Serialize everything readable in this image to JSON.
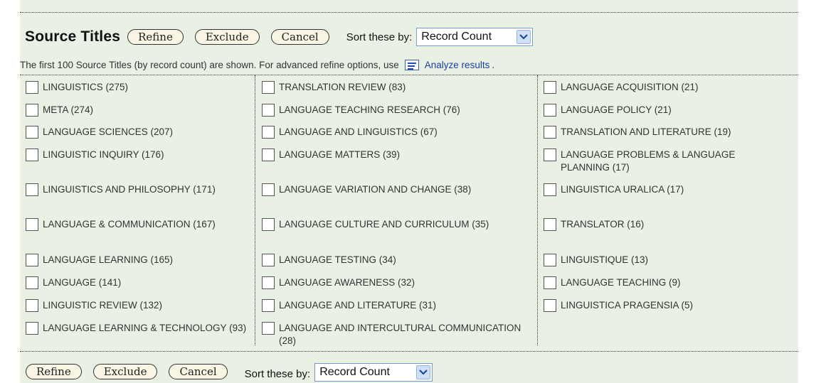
{
  "section_title": "Source Titles",
  "buttons": {
    "refine": "Refine",
    "exclude": "Exclude",
    "cancel": "Cancel"
  },
  "sort": {
    "label": "Sort these by:",
    "selected": "Record Count"
  },
  "info": {
    "text": "The first 100 Source Titles (by record count) are shown. For advanced refine options, use",
    "link": "Analyze results",
    "suffix": "."
  },
  "columns": [
    [
      "LINGUISTICS (275)",
      "META (274)",
      "LANGUAGE SCIENCES (207)",
      "LINGUISTIC INQUIRY (176)",
      "LINGUISTICS AND PHILOSOPHY (171)",
      "LANGUAGE & COMMUNICATION (167)",
      "LANGUAGE LEARNING (165)",
      "LANGUAGE (141)",
      "LINGUISTIC REVIEW (132)",
      "LANGUAGE LEARNING & TECHNOLOGY (93)"
    ],
    [
      "TRANSLATION REVIEW (83)",
      "LANGUAGE TEACHING RESEARCH (76)",
      "LANGUAGE AND LINGUISTICS (67)",
      "LANGUAGE MATTERS (39)",
      "LANGUAGE VARIATION AND CHANGE (38)",
      "LANGUAGE CULTURE AND CURRICULUM (35)",
      "LANGUAGE TESTING (34)",
      "LANGUAGE AWARENESS (32)",
      "LANGUAGE AND LITERATURE (31)",
      "LANGUAGE AND INTERCULTURAL COMMUNICATION (28)"
    ],
    [
      "LANGUAGE ACQUISITION (21)",
      "LANGUAGE POLICY (21)",
      "TRANSLATION AND LITERATURE (19)",
      "LANGUAGE PROBLEMS & LANGUAGE PLANNING (17)",
      "LINGUISTICA URALICA (17)",
      "TRANSLATOR (16)",
      "LINGUISTIQUE (13)",
      "LANGUAGE TEACHING (9)",
      "LINGUISTICA PRAGENSIA (5)"
    ]
  ],
  "icons": {
    "analyze": "analyze-results-icon",
    "dropdown": "chevron-down-icon"
  },
  "colors": {
    "panel_bg": "#e8f1e4",
    "link": "#1a3f9c",
    "select_border": "#7a9cc4"
  }
}
